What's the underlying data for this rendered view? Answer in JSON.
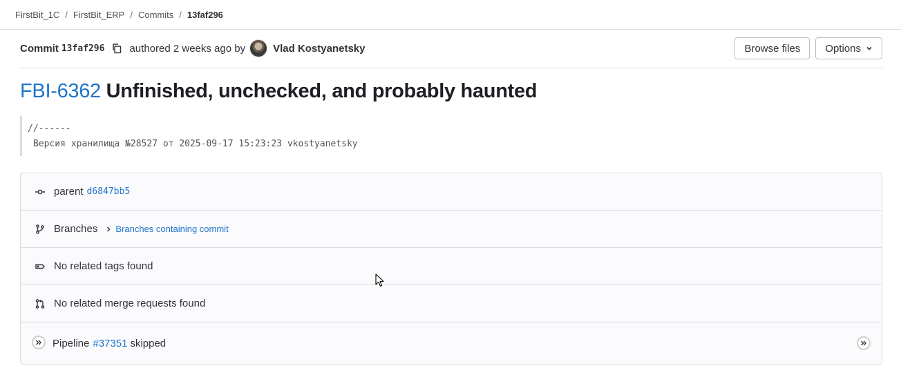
{
  "breadcrumb": {
    "items": [
      "FirstBit_1C",
      "FirstBit_ERP",
      "Commits"
    ],
    "current": "13faf296",
    "separator": "/"
  },
  "header": {
    "commit_label": "Commit",
    "sha": "13faf296",
    "authored_text": "authored 2 weeks ago by",
    "author": "Vlad Kostyanetsky",
    "browse_files_label": "Browse files",
    "options_label": "Options"
  },
  "title": {
    "issue": "FBI-6362",
    "text": "Unfinished, unchecked, and probably haunted"
  },
  "description": {
    "line1": "//------",
    "line2": "Версия хранилища №28527 от 2025-09-17 15:23:23 vkostyanetsky"
  },
  "info": {
    "parent_label": "parent",
    "parent_sha": "d6847bb5",
    "branches_label": "Branches",
    "branches_link": "Branches containing commit",
    "tags_text": "No related tags found",
    "mr_text": "No related merge requests found",
    "pipeline_label": "Pipeline",
    "pipeline_id": "#37351",
    "pipeline_status": "skipped"
  },
  "colors": {
    "link": "#1f75cb",
    "border": "#dcdcde",
    "panel_bg": "#fbfafd"
  }
}
